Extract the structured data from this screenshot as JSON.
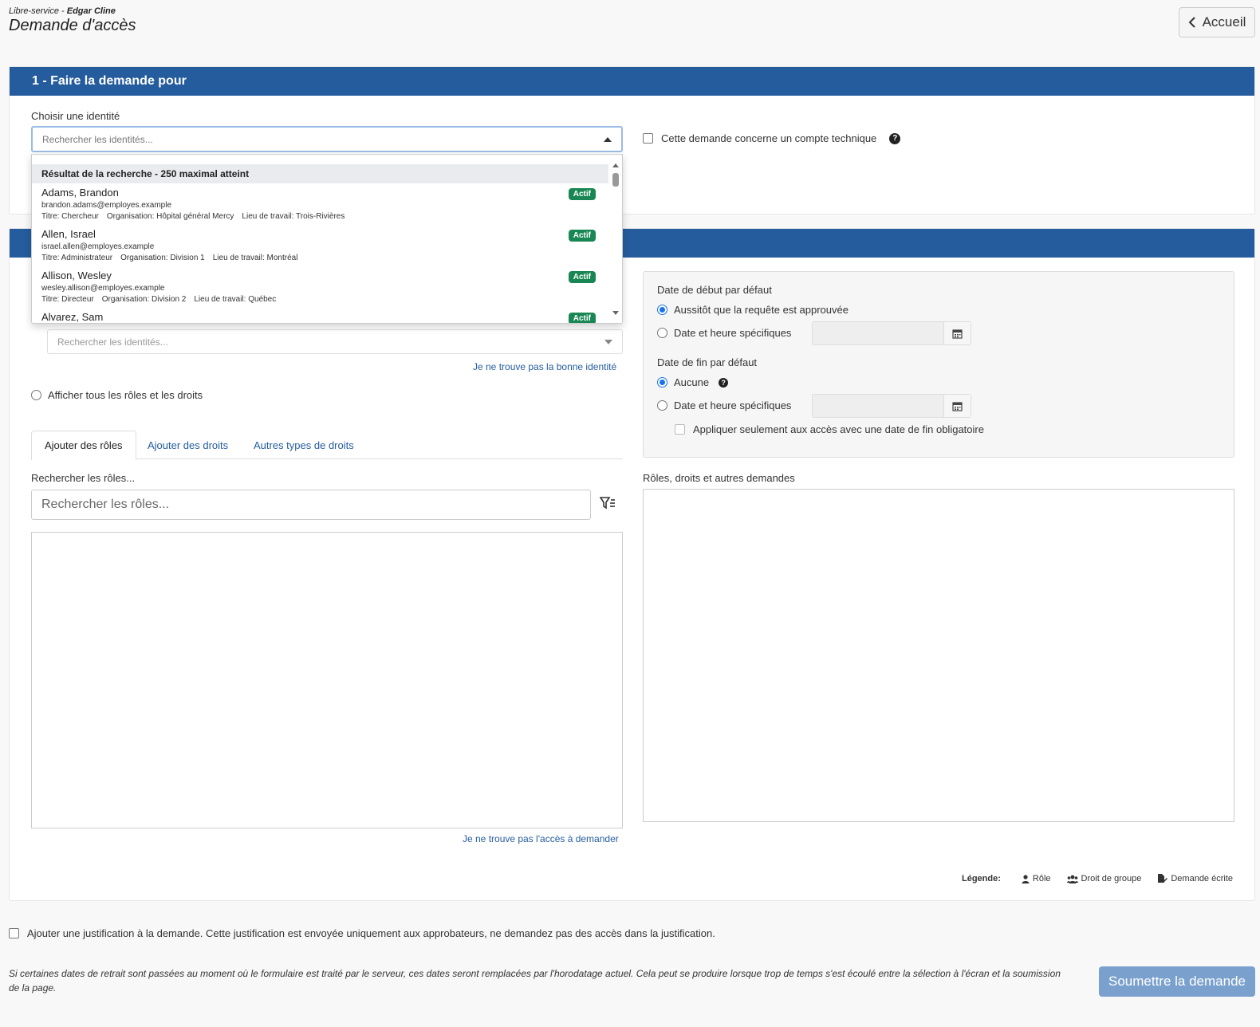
{
  "header": {
    "breadcrumb_prefix": "Libre-service - ",
    "breadcrumb_user": "Edgar Cline",
    "title": "Demande d'accès",
    "home_label": "Accueil"
  },
  "section1": {
    "title": "1 - Faire la demande pour",
    "identity_label": "Choisir une identité",
    "identity_placeholder": "Rechercher les identités...",
    "technical_account_label": "Cette demande concerne un compte technique"
  },
  "dropdown": {
    "header": "Résultat de la recherche - 250 maximal atteint",
    "items": [
      {
        "name": "Adams, Brandon",
        "email": "brandon.adams@employes.example",
        "title": "Titre: Chercheur",
        "org": "Organisation: Hôpital général Mercy",
        "location": "Lieu de travail: Trois-Rivières",
        "status": "Actif"
      },
      {
        "name": "Allen, Israel",
        "email": "israel.allen@employes.example",
        "title": "Titre: Administrateur",
        "org": "Organisation: Division 1",
        "location": "Lieu de travail: Montréal",
        "status": "Actif"
      },
      {
        "name": "Allison, Wesley",
        "email": "wesley.allison@employes.example",
        "title": "Titre: Directeur",
        "org": "Organisation: Division 2",
        "location": "Lieu de travail: Québec",
        "status": "Actif"
      },
      {
        "name": "Alvarez, Sam",
        "status": "Actif"
      }
    ]
  },
  "section2": {
    "identity_placeholder": "Rechercher les identités...",
    "wrong_identity_link": "Je ne trouve pas la bonne identité",
    "show_all_label": "Afficher tous les rôles et les droits",
    "tabs": [
      "Ajouter des rôles",
      "Ajouter des droits",
      "Autres types de droits"
    ],
    "roles_search_label": "Rechercher les rôles...",
    "roles_search_placeholder": "Rechercher les rôles...",
    "no_access_link": "Je ne trouve pas l'accès à demander",
    "start_date_label": "Date de début par défaut",
    "start_opt1": "Aussitôt que la requête est approuvée",
    "start_opt2": "Date et heure spécifiques",
    "end_date_label": "Date de fin par défaut",
    "end_opt1": "Aucune",
    "end_opt2": "Date et heure spécifiques",
    "apply_only_label": "Appliquer seulement aux accès avec une date de fin obligatoire",
    "selected_label": "Rôles, droits et autres demandes",
    "legend_label": "Légende:",
    "legend_role": "Rôle",
    "legend_group": "Droit de groupe",
    "legend_written": "Demande écrite"
  },
  "footer": {
    "justification_label": "Ajouter une justification à la demande. Cette justification est envoyée uniquement aux approbateurs, ne demandez pas des accès dans la justification.",
    "note": "Si certaines dates de retrait sont passées au moment où le formulaire est traité par le serveur, ces dates seront remplacées par l'horodatage actuel. Cela peut se produire lorsque trop de temps s'est écoulé entre la sélection à l'écran et la soumission de la page.",
    "submit_label": "Soumettre la demande"
  },
  "colors": {
    "header_blue": "#245c9e",
    "badge_green": "#198754",
    "submit_blue": "#7aa1cd"
  }
}
